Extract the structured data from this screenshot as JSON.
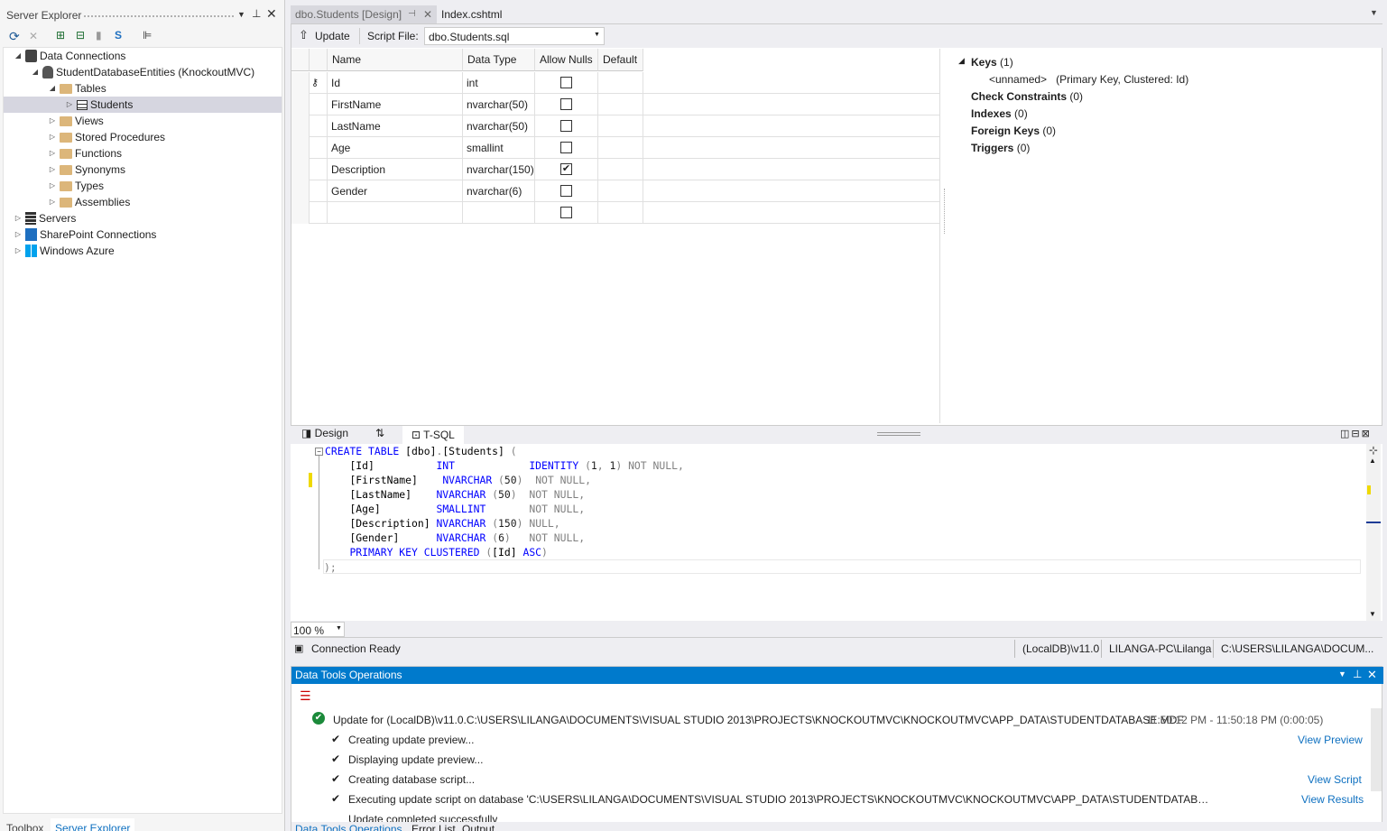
{
  "server_explorer": {
    "title": "Server Explorer",
    "tree": [
      {
        "label": "Data Connections"
      },
      {
        "label": "StudentDatabaseEntities (KnockoutMVC)"
      },
      {
        "label": "Tables"
      },
      {
        "label": "Students"
      },
      {
        "label": "Views"
      },
      {
        "label": "Stored Procedures"
      },
      {
        "label": "Functions"
      },
      {
        "label": "Synonyms"
      },
      {
        "label": "Types"
      },
      {
        "label": "Assemblies"
      },
      {
        "label": "Servers"
      },
      {
        "label": "SharePoint Connections"
      },
      {
        "label": "Windows Azure"
      }
    ],
    "bottom_tabs": [
      "Toolbox",
      "Server Explorer"
    ]
  },
  "doc_tabs": [
    "dbo.Students [Design]",
    "Index.cshtml"
  ],
  "designer": {
    "update_label": "Update",
    "script_file_label": "Script File:",
    "script_file_value": "dbo.Students.sql",
    "columns": [
      "Name",
      "Data Type",
      "Allow Nulls",
      "Default"
    ],
    "rows": [
      {
        "name": "Id",
        "type": "int",
        "nulls": false,
        "key": true
      },
      {
        "name": "FirstName",
        "type": "nvarchar(50)",
        "nulls": false
      },
      {
        "name": "LastName",
        "type": "nvarchar(50)",
        "nulls": false
      },
      {
        "name": "Age",
        "type": "smallint",
        "nulls": false
      },
      {
        "name": "Description",
        "type": "nvarchar(150)",
        "nulls": true
      },
      {
        "name": "Gender",
        "type": "nvarchar(6)",
        "nulls": false
      }
    ],
    "keys": {
      "keys_label": "Keys",
      "keys_count": "(1)",
      "unnamed": "<unnamed>",
      "unnamed_detail": "(Primary Key, Clustered: Id)",
      "check_label": "Check Constraints",
      "check_count": "(0)",
      "indexes_label": "Indexes",
      "indexes_count": "(0)",
      "fk_label": "Foreign Keys",
      "fk_count": "(0)",
      "triggers_label": "Triggers",
      "triggers_count": "(0)"
    }
  },
  "tsql": {
    "tab_design": "Design",
    "tab_tsql": "T-SQL",
    "zoom": "100 %",
    "status": "Connection Ready",
    "server": "(LocalDB)\\v11.0",
    "user": "LILANGA-PC\\Lilanga",
    "path": "C:\\USERS\\LILANGA\\DOCUM..."
  },
  "dto": {
    "title": "Data Tools Operations",
    "update_line": "Update for (LocalDB)\\v11.0.C:\\USERS\\LILANGA\\DOCUMENTS\\VISUAL STUDIO 2013\\PROJECTS\\KNOCKOUTMVC\\KNOCKOUTMVC\\APP_DATA\\STUDENTDATABASE.MDF",
    "time": "11:50:12 PM - 11:50:18 PM (0:00:05)",
    "steps": [
      "Creating update preview...",
      "Displaying update preview...",
      "Creating database script...",
      "Executing update script on database 'C:\\USERS\\LILANGA\\DOCUMENTS\\VISUAL STUDIO 2013\\PROJECTS\\KNOCKOUTMVC\\KNOCKOUTMVC\\APP_DATA\\STUDENTDATABASE.MDF'...",
      "Update completed successfully"
    ],
    "view_preview": "View Preview",
    "view_script": "View Script",
    "view_results": "View Results",
    "bottom_tabs": [
      "Data Tools Operations",
      "Error List",
      "Output"
    ]
  }
}
